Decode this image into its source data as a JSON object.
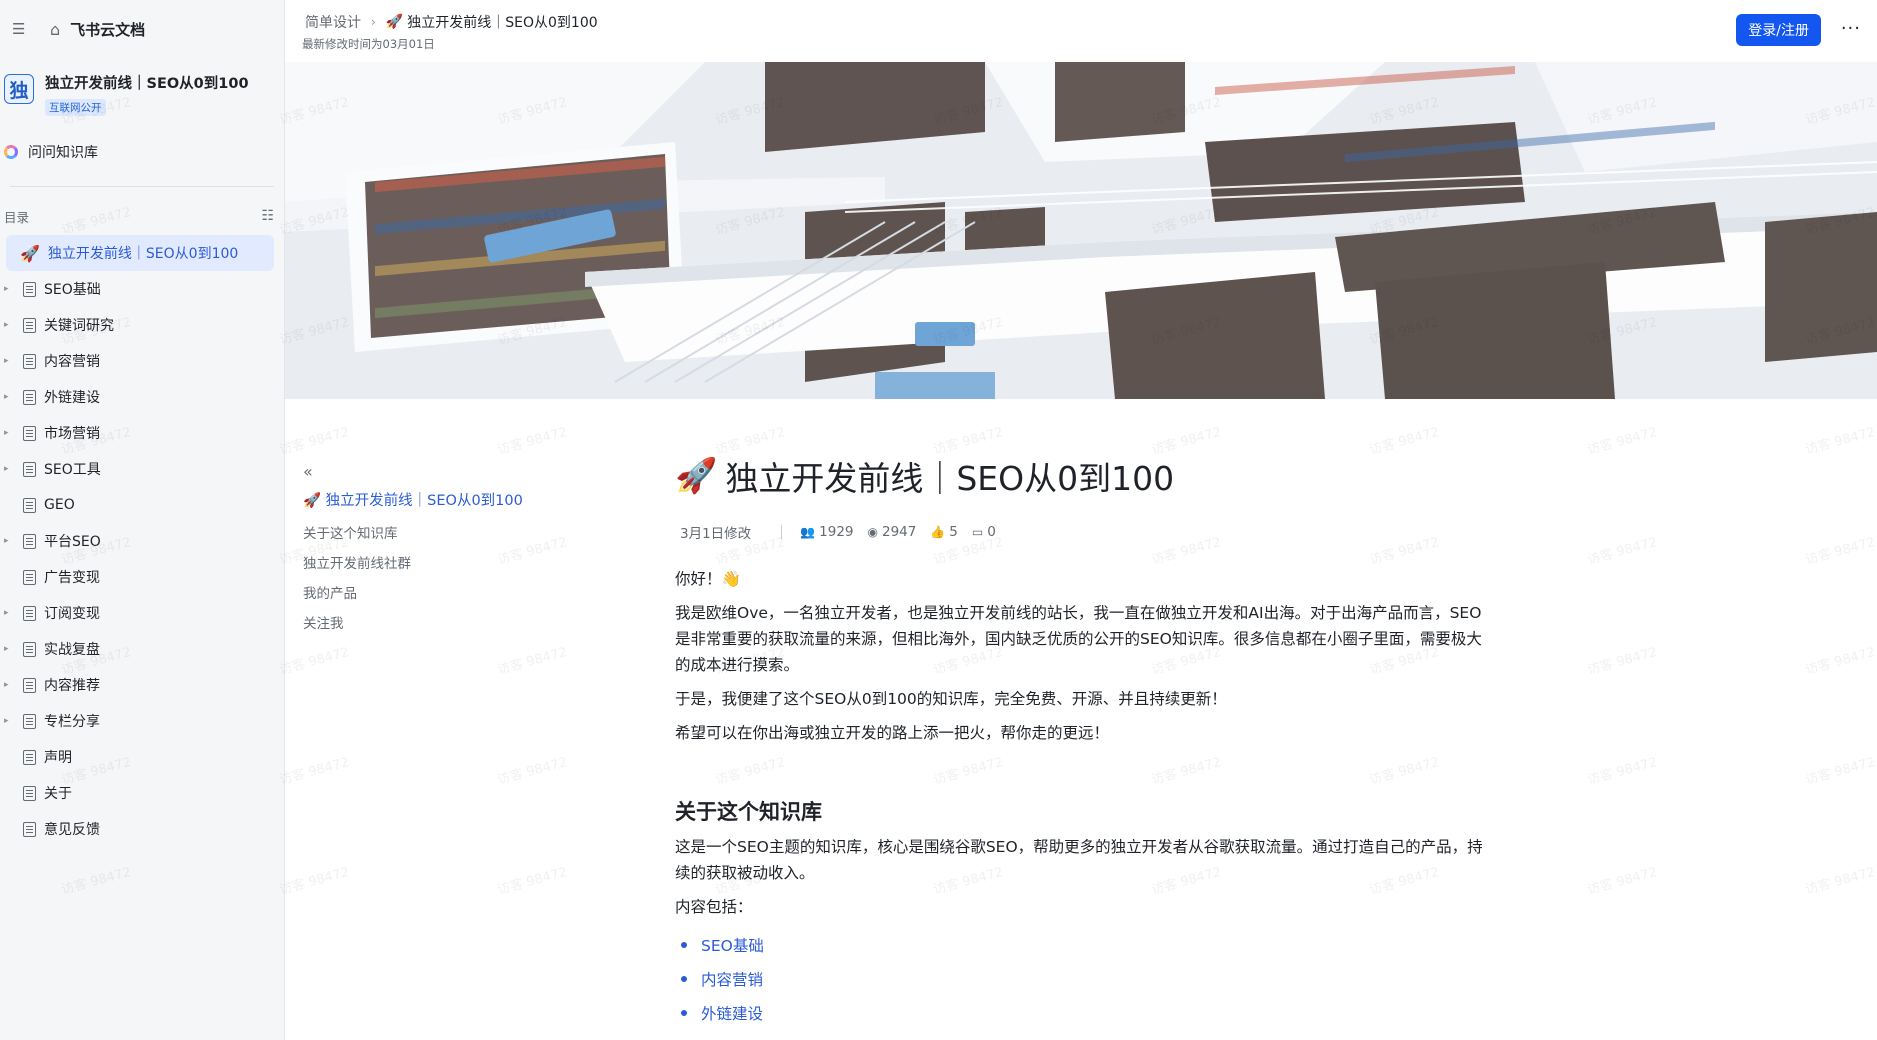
{
  "sidebar": {
    "brand": "飞书云文档",
    "space": {
      "avatar": "独",
      "name": "独立开发前线｜SEO从0到100",
      "badge": "互联网公开"
    },
    "ask": "问问知识库",
    "toc_label": "目录",
    "items": [
      {
        "label": "独立开发前线｜SEO从0到100",
        "active": true,
        "expandable": false
      },
      {
        "label": "SEO基础",
        "expandable": true
      },
      {
        "label": "关键词研究",
        "expandable": true
      },
      {
        "label": "内容营销",
        "expandable": true
      },
      {
        "label": "外链建设",
        "expandable": true
      },
      {
        "label": "市场营销",
        "expandable": true
      },
      {
        "label": "SEO工具",
        "expandable": true
      },
      {
        "label": "GEO",
        "expandable": false
      },
      {
        "label": "平台SEO",
        "expandable": true
      },
      {
        "label": "广告变现",
        "expandable": false
      },
      {
        "label": "订阅变现",
        "expandable": true
      },
      {
        "label": "实战复盘",
        "expandable": true
      },
      {
        "label": "内容推荐",
        "expandable": true
      },
      {
        "label": "专栏分享",
        "expandable": true
      },
      {
        "label": "声明",
        "expandable": false
      },
      {
        "label": "关于",
        "expandable": false
      },
      {
        "label": "意见反馈",
        "expandable": false
      }
    ]
  },
  "header": {
    "breadcrumb_parent": "简单设计",
    "breadcrumb_current": "独立开发前线｜SEO从0到100",
    "modified": "最新修改时间为03月01日",
    "login": "登录/注册",
    "more": "···"
  },
  "outline": {
    "title": "独立开发前线｜SEO从0到100",
    "items": [
      "关于这个知识库",
      "独立开发前线社群",
      "我的产品",
      "关注我"
    ]
  },
  "doc": {
    "title": "独立开发前线｜SEO从0到100",
    "meta": {
      "modified": "3月1日修改",
      "readers": "1929",
      "views": "2947",
      "likes": "5",
      "comments": "0"
    },
    "greeting": "你好！👋",
    "p1": "我是欧维Ove，一名独立开发者，也是独立开发前线的站长，我一直在做独立开发和AI出海。对于出海产品而言，SEO是非常重要的获取流量的来源，但相比海外，国内缺乏优质的公开的SEO知识库。很多信息都在小圈子里面，需要极大的成本进行摸索。",
    "p2": "于是，我便建了这个SEO从0到100的知识库，完全免费、开源、并且持续更新！",
    "p3": "希望可以在你出海或独立开发的路上添一把火，帮你走的更远！",
    "h2": "关于这个知识库",
    "p4": "这是一个SEO主题的知识库，核心是围绕谷歌SEO，帮助更多的独立开发者从谷歌获取流量。通过打造自己的产品，持续的获取被动收入。",
    "p5": "内容包括：",
    "links": [
      "SEO基础",
      "内容营销",
      "外链建设"
    ]
  },
  "watermark": "访客 98472",
  "colors": {
    "accent": "#1456f0",
    "link": "#2b5cd6",
    "active_bg": "#e1eaff",
    "sidebar_bg": "#f5f6f7"
  }
}
